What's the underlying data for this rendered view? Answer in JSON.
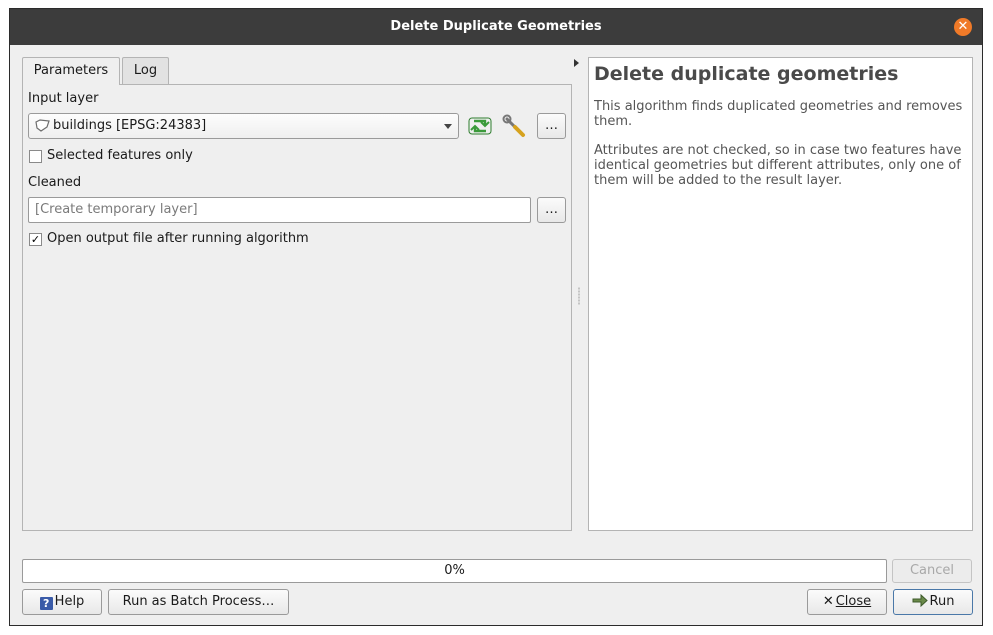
{
  "window": {
    "title": "Delete Duplicate Geometries",
    "close_icon": "close-icon"
  },
  "tabs": [
    {
      "label": "Parameters",
      "active": true
    },
    {
      "label": "Log",
      "active": false
    }
  ],
  "parameters": {
    "input_layer_label": "Input layer",
    "input_layer_value": "buildings [EPSG:24383]",
    "input_layer_icon": "polygon-layer-icon",
    "selected_only_label": "Selected features only",
    "selected_only_checked": false,
    "cleaned_label": "Cleaned",
    "cleaned_placeholder": "[Create temporary layer]",
    "browse_label": "…",
    "open_output_label": "Open output file after running algorithm",
    "open_output_checked": true,
    "check_mark": "✓"
  },
  "help": {
    "title": "Delete duplicate geometries",
    "paragraph1": "This algorithm finds duplicated geometries and removes them.",
    "paragraph2": "Attributes are not checked, so in case two features have identical geometries but different attributes, only one of them will be added to the result layer."
  },
  "progress": {
    "value": 0,
    "text": "0%",
    "cancel_label": "Cancel"
  },
  "footer": {
    "help_label": "Help",
    "batch_label": "Run as Batch Process…",
    "close_label": "Close",
    "run_label": "Run"
  },
  "colors": {
    "titlebar": "#3c3c3c",
    "close_button": "#f07a28",
    "iterate_icon": "#3a9a3a",
    "help_icon": "#3a5ba8",
    "run_button_border": "#4a78a8"
  }
}
